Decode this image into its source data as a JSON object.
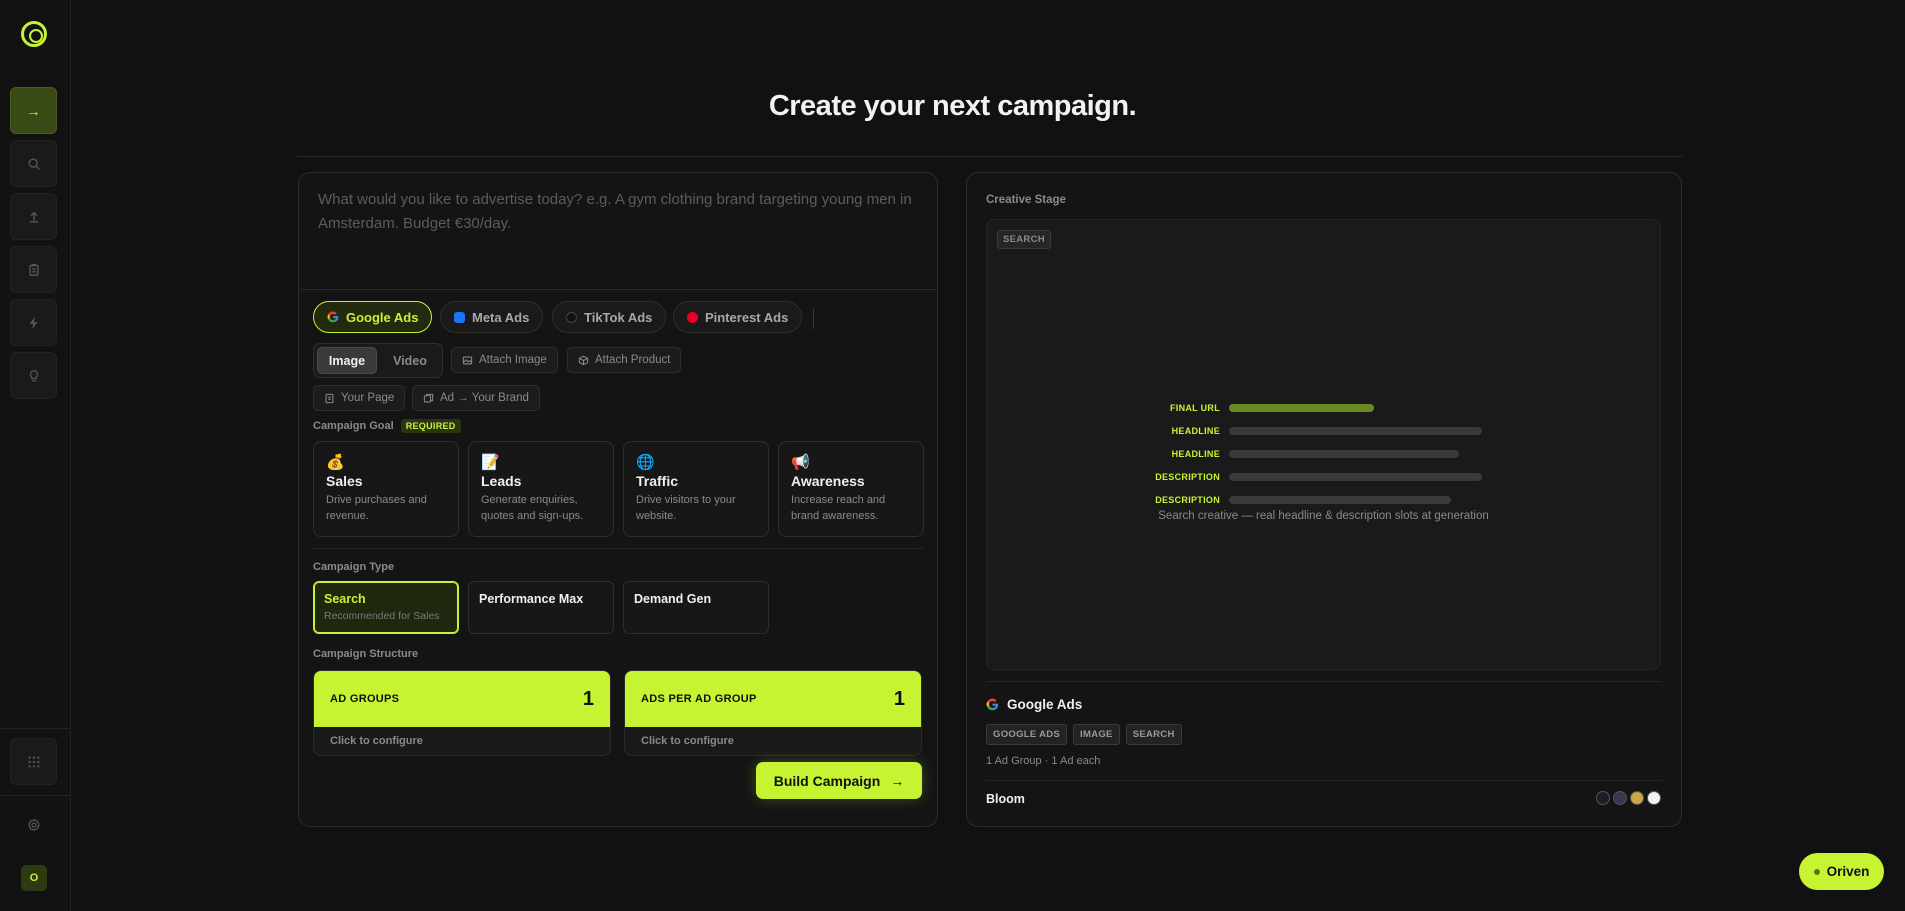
{
  "sidebar": {
    "avatar_initial": "O"
  },
  "page_title": "Create your next campaign.",
  "prompt": {
    "placeholder": "What would you like to advertise today? e.g. A gym clothing brand targeting young men in Amsterdam. Budget €30/day."
  },
  "platforms": [
    {
      "label": "Google Ads",
      "icon": "google-icon",
      "active": true
    },
    {
      "label": "Meta Ads",
      "icon": "meta-icon",
      "active": false
    },
    {
      "label": "TikTok Ads",
      "icon": "tiktok-icon",
      "active": false
    },
    {
      "label": "Pinterest Ads",
      "icon": "pinterest-icon",
      "active": false
    }
  ],
  "media": {
    "image": "Image",
    "video": "Video",
    "selected": "Image"
  },
  "attach": {
    "image": "Attach Image",
    "product": "Attach Product"
  },
  "links": {
    "your_page": "Your Page",
    "ad_to_brand": "Ad → Your Brand"
  },
  "campaign_goal": {
    "label": "Campaign Goal",
    "required": "REQUIRED",
    "options": [
      {
        "emoji": "💰",
        "title": "Sales",
        "desc": "Drive purchases and revenue."
      },
      {
        "emoji": "📝",
        "title": "Leads",
        "desc": "Generate enquiries, quotes and sign-ups."
      },
      {
        "emoji": "🌐",
        "title": "Traffic",
        "desc": "Drive visitors to your website."
      },
      {
        "emoji": "📢",
        "title": "Awareness",
        "desc": "Increase reach and brand awareness."
      }
    ]
  },
  "campaign_type": {
    "label": "Campaign Type",
    "options": [
      {
        "title": "Search",
        "sub": "Recommended for Sales",
        "selected": true
      },
      {
        "title": "Performance Max",
        "sub": "",
        "selected": false
      },
      {
        "title": "Demand Gen",
        "sub": "",
        "selected": false
      }
    ]
  },
  "campaign_structure": {
    "label": "Campaign Structure",
    "ad_groups": {
      "label": "AD GROUPS",
      "value": "1",
      "hint": "Click to configure"
    },
    "ads_per_group": {
      "label": "ADS PER AD GROUP",
      "value": "1",
      "hint": "Click to configure"
    }
  },
  "build_button": "Build Campaign",
  "creative_stage": {
    "label": "Creative Stage",
    "tag": "SEARCH",
    "slots": [
      {
        "label": "FINAL URL",
        "fill": 0.55
      },
      {
        "label": "HEADLINE",
        "fill": 0.96
      },
      {
        "label": "HEADLINE",
        "fill": 0.87
      },
      {
        "label": "DESCRIPTION",
        "fill": 0.96
      },
      {
        "label": "DESCRIPTION",
        "fill": 0.84
      }
    ],
    "caption": "Search creative — real headline & description slots at generation"
  },
  "summary": {
    "platform": "Google Ads",
    "tags": [
      "GOOGLE ADS",
      "IMAGE",
      "SEARCH"
    ],
    "meta": "1 Ad Group · 1 Ad each",
    "brand": "Bloom",
    "swatches": [
      "#1e1e2a",
      "#3a3550",
      "#c9a646",
      "#f2f2f2"
    ]
  },
  "assistant_button": "Oriven",
  "colors": {
    "accent": "#c6f432",
    "background": "#111111"
  }
}
